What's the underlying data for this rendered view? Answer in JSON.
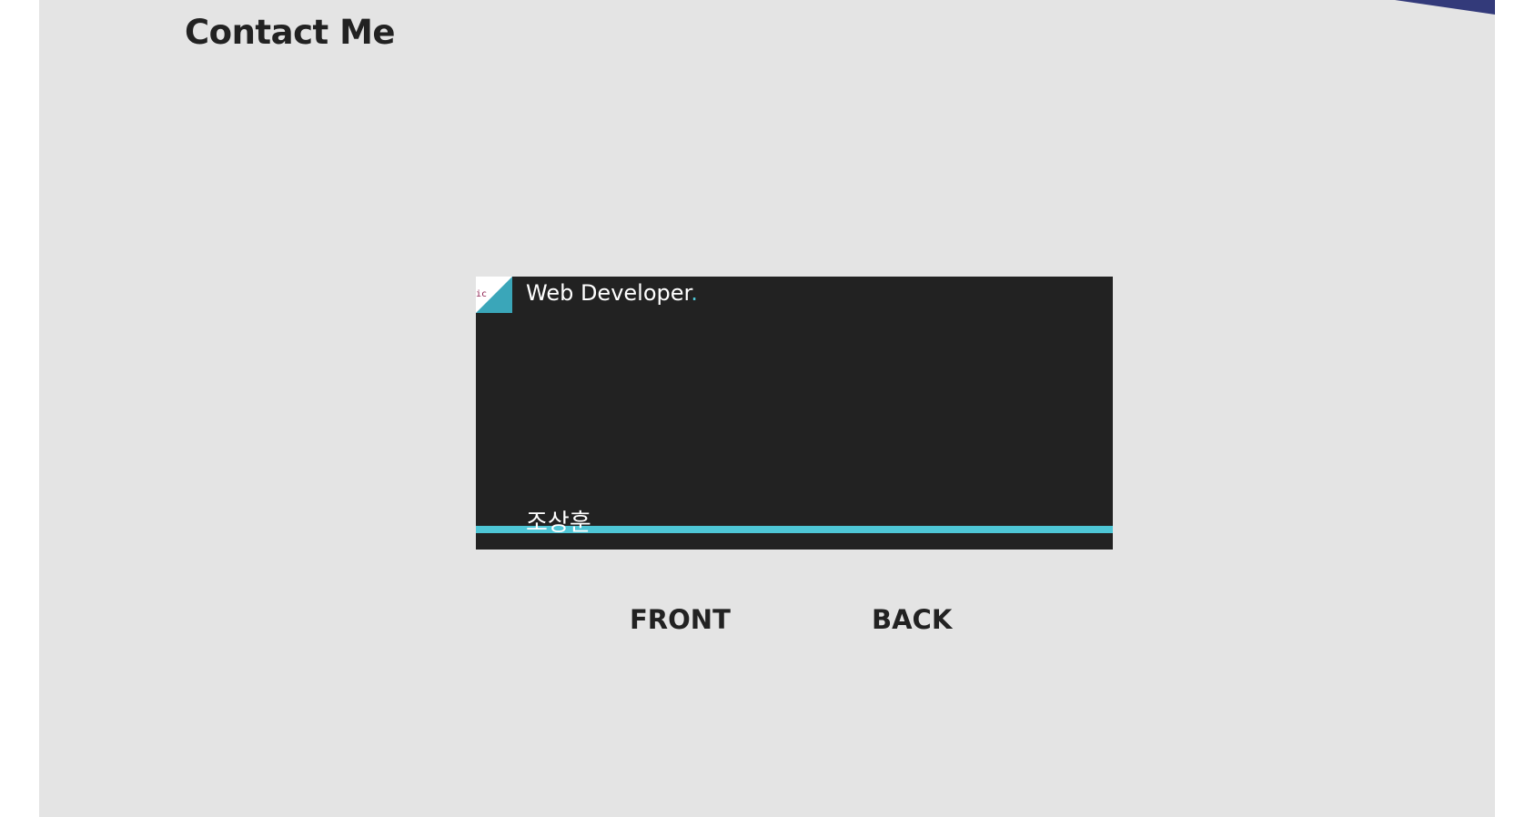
{
  "header": {
    "title": "Contact Me"
  },
  "card": {
    "thumb_text": "ic",
    "role": "Web Developer",
    "role_suffix": ".",
    "name": "조상훈"
  },
  "controls": {
    "front_label": "FRONT",
    "back_label": "BACK"
  },
  "colors": {
    "background": "#e4e4e4",
    "card": "#222222",
    "accent": "#4ec6d6",
    "thumb_accent": "#3aa6b9",
    "corner_accent": "#333a7a",
    "text_dark": "#222222"
  }
}
